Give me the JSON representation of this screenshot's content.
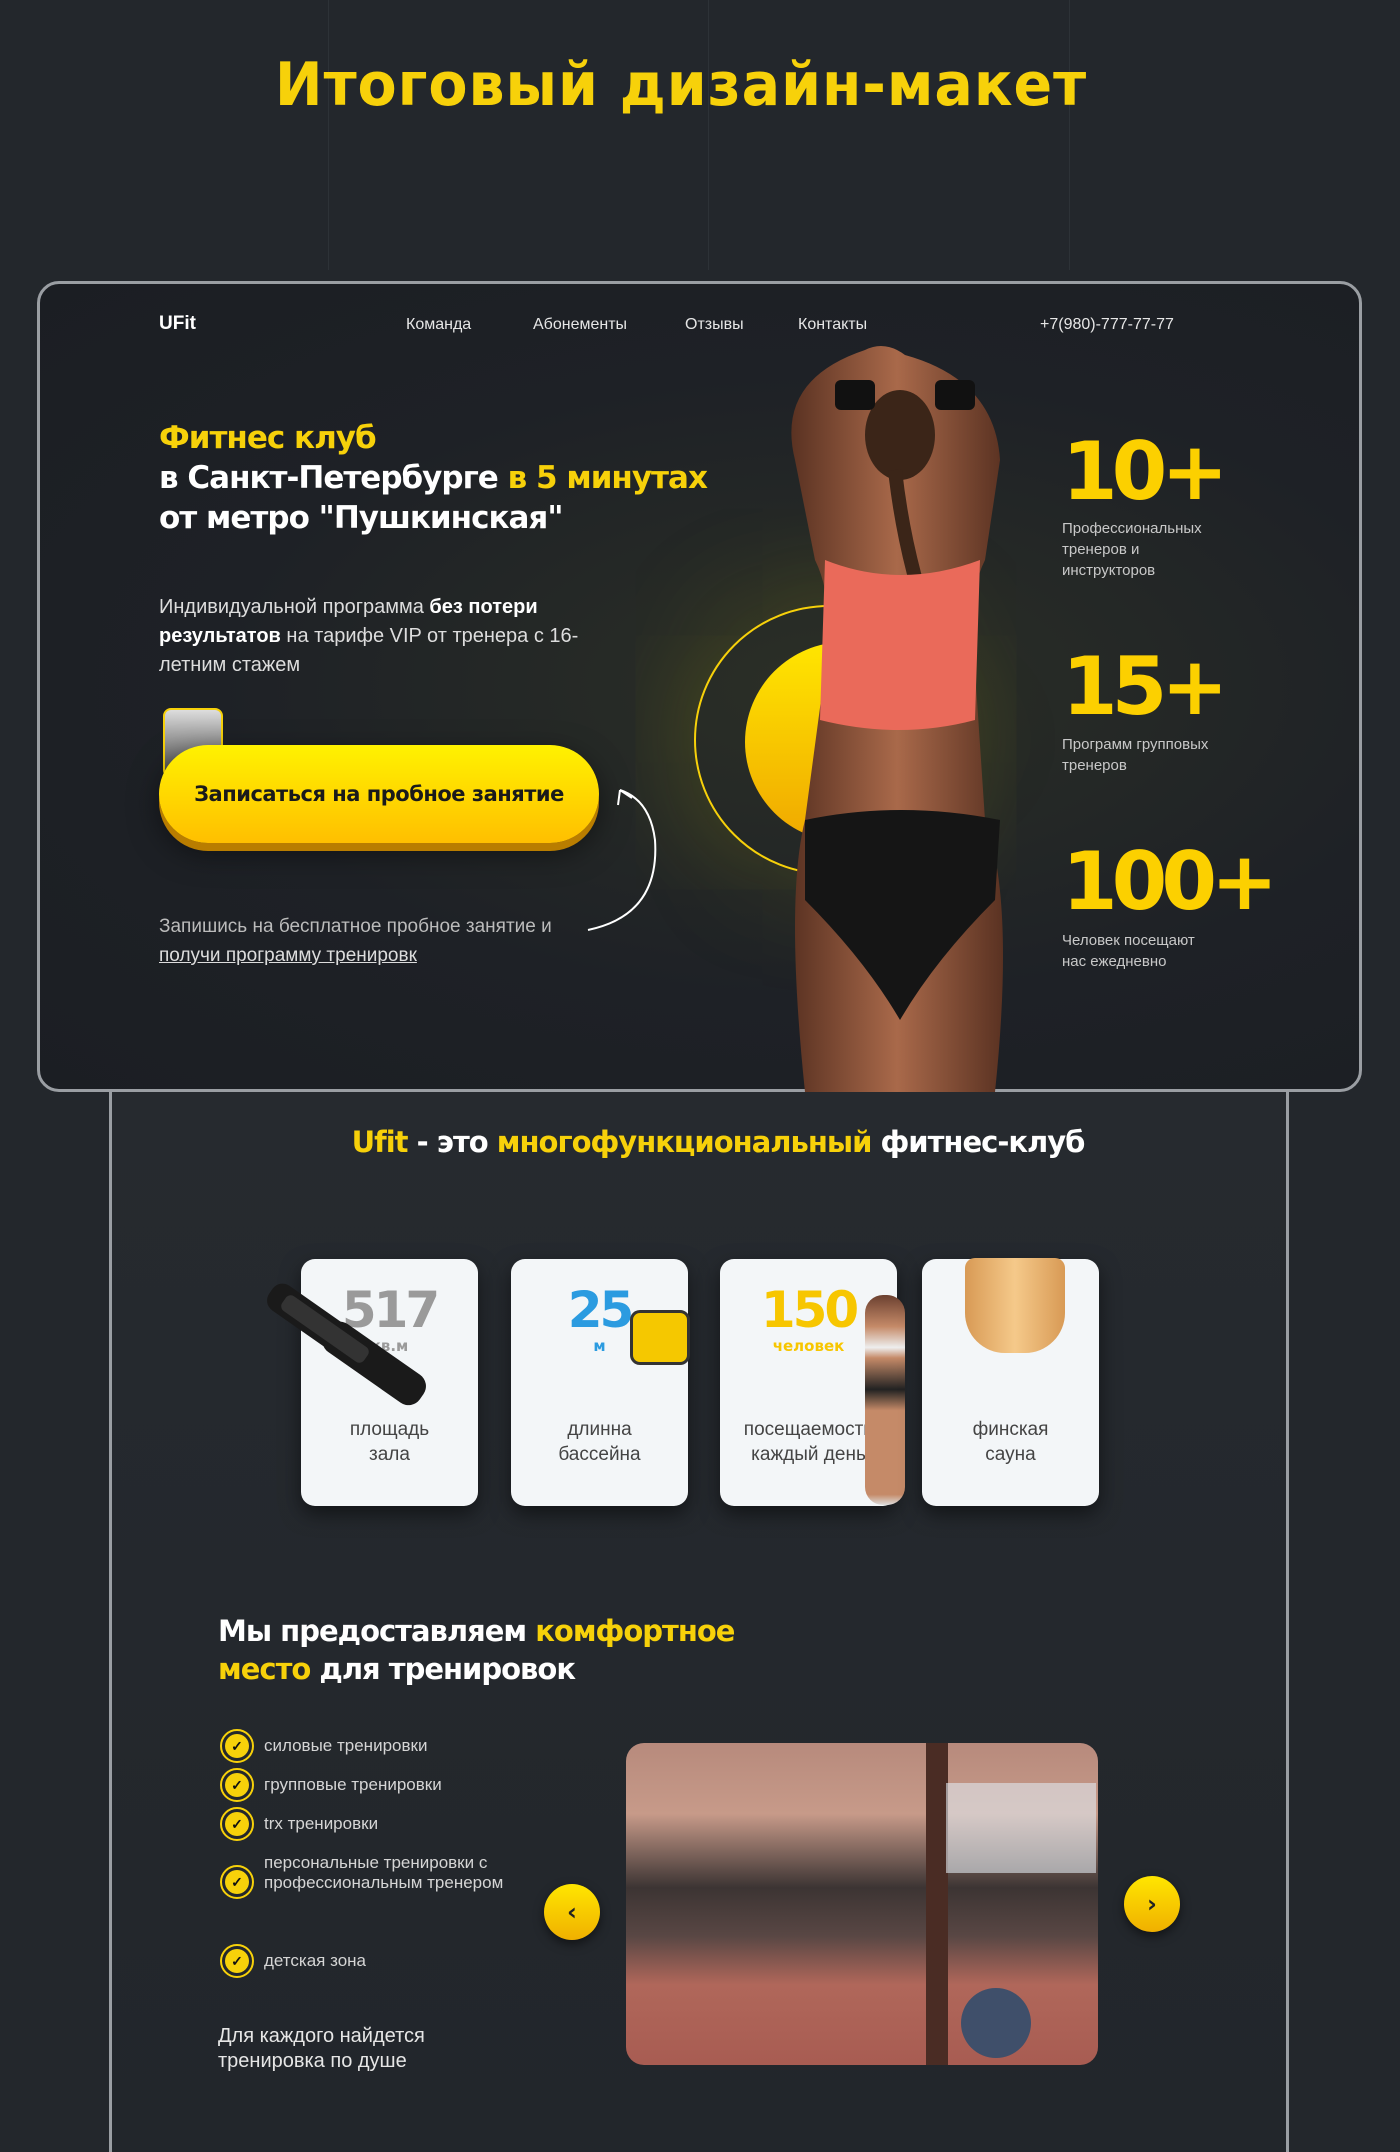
{
  "page_title": "Итоговый дизайн-макет",
  "header": {
    "logo": "UFit",
    "nav": [
      "Команда",
      "Абонементы",
      "Отзывы",
      "Контакты"
    ],
    "phone": "+7(980)-777-77-77"
  },
  "hero": {
    "line1": "Фитнес клуб",
    "line2a": "в Санкт-Петербурге ",
    "line2b": "в 5 минутах",
    "line3": "от метро \"Пушкинская\"",
    "p_a": "Индивидуальной программа ",
    "p_b": "без потери результатов",
    "p_c": " на тарифе VIP от тренера с 16-летним стажем",
    "cta": "Записаться на пробное занятие",
    "note_a": "Запишись на бесплатное пробное занятие и ",
    "note_link": "получи программу тренировк"
  },
  "stats": [
    {
      "value": "10+",
      "label": "Профессиональных тренеров и инструкторов"
    },
    {
      "value": "15+",
      "label": "Программ групповых тренеров"
    },
    {
      "value": "100+",
      "label": "Человек посещают нас ежедневно"
    }
  ],
  "about": {
    "brand": "Ufit",
    "mid": " - это ",
    "accent": "многофункциональный",
    "tail": " фитнес-клуб",
    "cards": [
      {
        "num": "517",
        "unit": "кв.м",
        "label": "площадь зала",
        "color": "#9a9a9a"
      },
      {
        "num": "25",
        "unit": "м",
        "label": "длинна бассейна",
        "color": "#2b9be0"
      },
      {
        "num": "150",
        "unit": "человек",
        "label": "посещаемость каждый день",
        "color": "#f7c600"
      },
      {
        "num": "",
        "unit": "",
        "label": "финская сауна",
        "color": "#444"
      }
    ]
  },
  "comfort": {
    "h_a": "Мы предоставляем ",
    "h_b": "комфортное",
    "h_c": "место",
    "h_d": " для тренировок",
    "items": [
      "силовые тренировки",
      "групповые тренировки",
      "trx тренировки",
      "персональные тренировки с профессиональным тренером",
      "детская зона"
    ],
    "bottom": "Для каждого найдется тренировка по душе",
    "prev": "‹",
    "next": "›"
  }
}
